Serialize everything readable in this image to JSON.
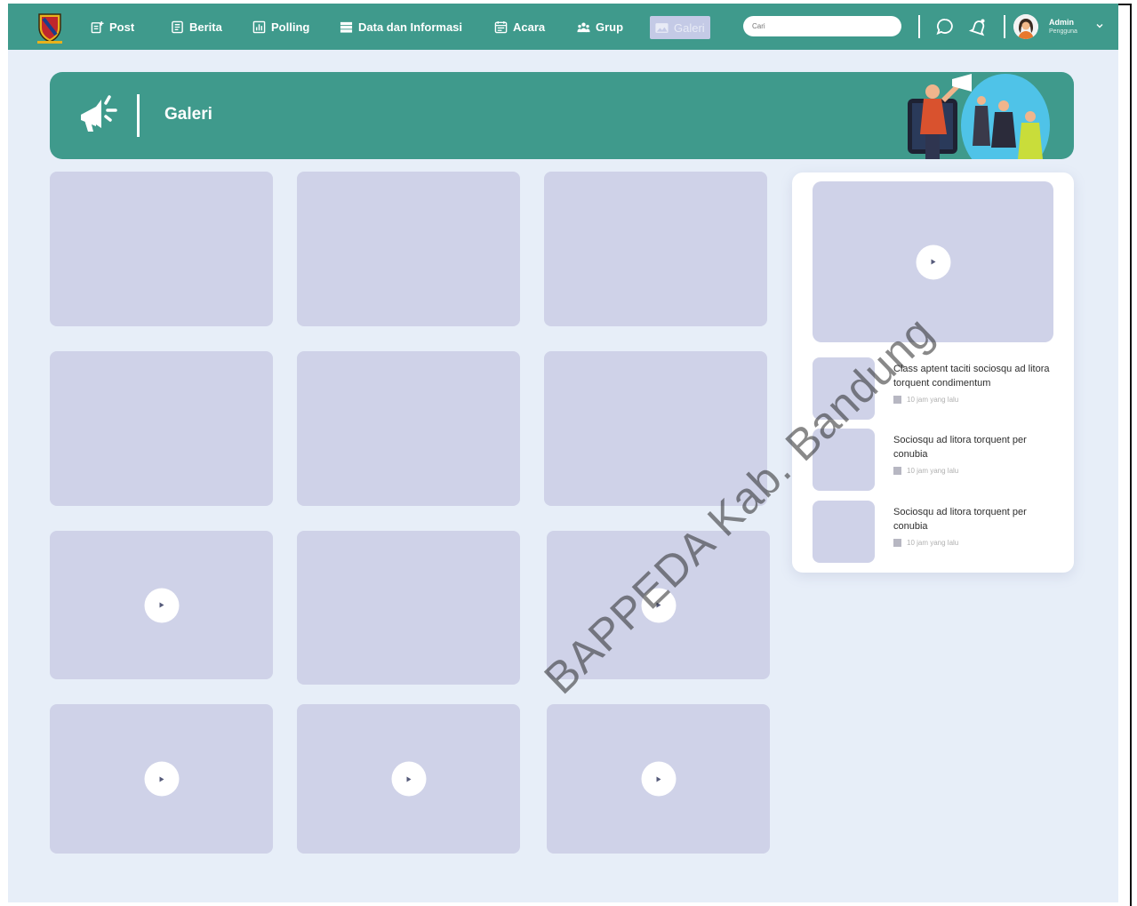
{
  "nav": {
    "items": [
      {
        "label": "Post",
        "icon": "post-add-icon"
      },
      {
        "label": "Berita",
        "icon": "news-icon"
      },
      {
        "label": "Polling",
        "icon": "poll-icon"
      },
      {
        "label": "Data dan Informasi",
        "icon": "database-icon"
      },
      {
        "label": "Acara",
        "icon": "calendar-icon"
      },
      {
        "label": "Grup",
        "icon": "group-icon"
      },
      {
        "label": "Galeri",
        "icon": "image-icon",
        "active": true
      }
    ],
    "search_placeholder": "Cari",
    "user": {
      "name": "Admin",
      "role": "Pengguna"
    }
  },
  "banner": {
    "title": "Galeri",
    "icon": "megaphone-icon"
  },
  "gallery": {
    "tiles": [
      {
        "type": "image"
      },
      {
        "type": "image"
      },
      {
        "type": "image"
      },
      {
        "type": "image"
      },
      {
        "type": "image"
      },
      {
        "type": "image"
      },
      {
        "type": "video"
      },
      {
        "type": "image"
      },
      {
        "type": "video"
      },
      {
        "type": "video"
      },
      {
        "type": "video"
      },
      {
        "type": "video"
      }
    ]
  },
  "sidebar": {
    "featured": {
      "type": "video"
    },
    "items": [
      {
        "title": "Class aptent taciti sociosqu ad litora torquent condimentum",
        "time": "10 jam yang lalu"
      },
      {
        "title": "Sociosqu ad litora torquent per conubia",
        "time": "10 jam yang lalu"
      },
      {
        "title": "Sociosqu ad litora torquent per conubia",
        "time": "10 jam yang lalu"
      }
    ]
  },
  "watermark": "BAPPEDA Kab. Bandung",
  "colors": {
    "primary": "#3f9a8c",
    "background": "#e7eef8",
    "placeholder": "#cfd2e8"
  }
}
